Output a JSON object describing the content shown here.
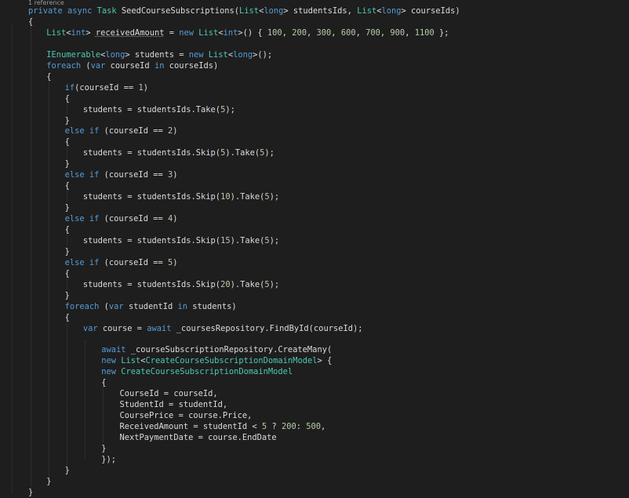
{
  "editor": {
    "codelens": "1 reference",
    "colors": {
      "background": "#1e1e1e",
      "default": "#dcdcdc",
      "keyword": "#569cd6",
      "type": "#4ec9b0",
      "number": "#b5cea8",
      "codelens": "#999999"
    },
    "lines": [
      {
        "indent": 0,
        "tokens": [
          [
            "keyword",
            "private async "
          ],
          [
            "type",
            "Task"
          ],
          [
            "default",
            " SeedCourseSubscriptions("
          ],
          [
            "type",
            "List"
          ],
          [
            "default",
            "<"
          ],
          [
            "keyword",
            "long"
          ],
          [
            "default",
            "> studentsIds, "
          ],
          [
            "type",
            "List"
          ],
          [
            "default",
            "<"
          ],
          [
            "keyword",
            "long"
          ],
          [
            "default",
            "> courseIds)"
          ]
        ]
      },
      {
        "indent": 0,
        "tokens": [
          [
            "default",
            "{"
          ]
        ]
      },
      {
        "indent": 1,
        "tokens": [
          [
            "type",
            "List"
          ],
          [
            "default",
            "<"
          ],
          [
            "keyword",
            "int"
          ],
          [
            "default",
            "> "
          ],
          [
            "squiggle",
            "receivedAmount"
          ],
          [
            "default",
            " = "
          ],
          [
            "keyword",
            "new "
          ],
          [
            "type",
            "List"
          ],
          [
            "default",
            "<"
          ],
          [
            "keyword",
            "int"
          ],
          [
            "default",
            ">() { "
          ],
          [
            "number",
            "100"
          ],
          [
            "default",
            ", "
          ],
          [
            "number",
            "200"
          ],
          [
            "default",
            ", "
          ],
          [
            "number",
            "300"
          ],
          [
            "default",
            ", "
          ],
          [
            "number",
            "600"
          ],
          [
            "default",
            ", "
          ],
          [
            "number",
            "700"
          ],
          [
            "default",
            ", "
          ],
          [
            "number",
            "900"
          ],
          [
            "default",
            ", "
          ],
          [
            "number",
            "1100"
          ],
          [
            "default",
            " };"
          ]
        ]
      },
      {
        "indent": 1,
        "tokens": []
      },
      {
        "indent": 1,
        "tokens": [
          [
            "type",
            "IEnumerable"
          ],
          [
            "default",
            "<"
          ],
          [
            "keyword",
            "long"
          ],
          [
            "default",
            "> students = "
          ],
          [
            "keyword",
            "new "
          ],
          [
            "type",
            "List"
          ],
          [
            "default",
            "<"
          ],
          [
            "keyword",
            "long"
          ],
          [
            "default",
            ">();"
          ]
        ]
      },
      {
        "indent": 1,
        "tokens": [
          [
            "keyword",
            "foreach"
          ],
          [
            "default",
            " ("
          ],
          [
            "keyword",
            "var"
          ],
          [
            "default",
            " courseId "
          ],
          [
            "keyword",
            "in"
          ],
          [
            "default",
            " courseIds)"
          ]
        ]
      },
      {
        "indent": 1,
        "tokens": [
          [
            "default",
            "{"
          ]
        ]
      },
      {
        "indent": 2,
        "tokens": [
          [
            "keyword",
            "if"
          ],
          [
            "default",
            "(courseId == "
          ],
          [
            "number",
            "1"
          ],
          [
            "default",
            ")"
          ]
        ]
      },
      {
        "indent": 2,
        "tokens": [
          [
            "default",
            "{"
          ]
        ]
      },
      {
        "indent": 3,
        "tokens": [
          [
            "default",
            "students = studentsIds.Take("
          ],
          [
            "number",
            "5"
          ],
          [
            "default",
            ");"
          ]
        ]
      },
      {
        "indent": 2,
        "tokens": [
          [
            "default",
            "}"
          ]
        ]
      },
      {
        "indent": 2,
        "tokens": [
          [
            "keyword",
            "else if"
          ],
          [
            "default",
            " (courseId == "
          ],
          [
            "number",
            "2"
          ],
          [
            "default",
            ")"
          ]
        ]
      },
      {
        "indent": 2,
        "tokens": [
          [
            "default",
            "{"
          ]
        ]
      },
      {
        "indent": 3,
        "tokens": [
          [
            "default",
            "students = studentsIds.Skip("
          ],
          [
            "number",
            "5"
          ],
          [
            "default",
            ").Take("
          ],
          [
            "number",
            "5"
          ],
          [
            "default",
            ");"
          ]
        ]
      },
      {
        "indent": 2,
        "tokens": [
          [
            "default",
            "}"
          ]
        ]
      },
      {
        "indent": 2,
        "tokens": [
          [
            "keyword",
            "else if"
          ],
          [
            "default",
            " (courseId == "
          ],
          [
            "number",
            "3"
          ],
          [
            "default",
            ")"
          ]
        ]
      },
      {
        "indent": 2,
        "tokens": [
          [
            "default",
            "{"
          ]
        ]
      },
      {
        "indent": 3,
        "tokens": [
          [
            "default",
            "students = studentsIds.Skip("
          ],
          [
            "number",
            "10"
          ],
          [
            "default",
            ").Take("
          ],
          [
            "number",
            "5"
          ],
          [
            "default",
            ");"
          ]
        ]
      },
      {
        "indent": 2,
        "tokens": [
          [
            "default",
            "}"
          ]
        ]
      },
      {
        "indent": 2,
        "tokens": [
          [
            "keyword",
            "else if"
          ],
          [
            "default",
            " (courseId == "
          ],
          [
            "number",
            "4"
          ],
          [
            "default",
            ")"
          ]
        ]
      },
      {
        "indent": 2,
        "tokens": [
          [
            "default",
            "{"
          ]
        ]
      },
      {
        "indent": 3,
        "tokens": [
          [
            "default",
            "students = studentsIds.Skip("
          ],
          [
            "number",
            "15"
          ],
          [
            "default",
            ").Take("
          ],
          [
            "number",
            "5"
          ],
          [
            "default",
            ");"
          ]
        ]
      },
      {
        "indent": 2,
        "tokens": [
          [
            "default",
            "}"
          ]
        ]
      },
      {
        "indent": 2,
        "tokens": [
          [
            "keyword",
            "else if"
          ],
          [
            "default",
            " (courseId == "
          ],
          [
            "number",
            "5"
          ],
          [
            "default",
            ")"
          ]
        ]
      },
      {
        "indent": 2,
        "tokens": [
          [
            "default",
            "{"
          ]
        ]
      },
      {
        "indent": 3,
        "tokens": [
          [
            "default",
            "students = studentsIds.Skip("
          ],
          [
            "number",
            "20"
          ],
          [
            "default",
            ").Take("
          ],
          [
            "number",
            "5"
          ],
          [
            "default",
            ");"
          ]
        ]
      },
      {
        "indent": 2,
        "tokens": [
          [
            "default",
            "}"
          ]
        ]
      },
      {
        "indent": 2,
        "tokens": [
          [
            "keyword",
            "foreach"
          ],
          [
            "default",
            " ("
          ],
          [
            "keyword",
            "var"
          ],
          [
            "default",
            " studentId "
          ],
          [
            "keyword",
            "in"
          ],
          [
            "default",
            " students)"
          ]
        ]
      },
      {
        "indent": 2,
        "tokens": [
          [
            "default",
            "{"
          ]
        ]
      },
      {
        "indent": 3,
        "tokens": [
          [
            "keyword",
            "var"
          ],
          [
            "default",
            " course = "
          ],
          [
            "keyword",
            "await"
          ],
          [
            "default",
            " _coursesRepository.FindById(courseId);"
          ]
        ]
      },
      {
        "indent": 3,
        "tokens": []
      },
      {
        "indent": 4,
        "tokens": [
          [
            "keyword",
            "await"
          ],
          [
            "default",
            " _courseSubscriptionRepository.CreateMany("
          ]
        ]
      },
      {
        "indent": 4,
        "tokens": [
          [
            "keyword",
            "new "
          ],
          [
            "type",
            "List"
          ],
          [
            "default",
            "<"
          ],
          [
            "type",
            "CreateCourseSubscriptionDomainModel"
          ],
          [
            "default",
            "> {"
          ]
        ]
      },
      {
        "indent": 4,
        "tokens": [
          [
            "keyword",
            "new "
          ],
          [
            "type",
            "CreateCourseSubscriptionDomainModel"
          ]
        ]
      },
      {
        "indent": 4,
        "tokens": [
          [
            "default",
            "{"
          ]
        ]
      },
      {
        "indent": 5,
        "tokens": [
          [
            "default",
            "CourseId = courseId,"
          ]
        ]
      },
      {
        "indent": 5,
        "tokens": [
          [
            "default",
            "StudentId = studentId,"
          ]
        ]
      },
      {
        "indent": 5,
        "tokens": [
          [
            "default",
            "CoursePrice = course.Price,"
          ]
        ]
      },
      {
        "indent": 5,
        "tokens": [
          [
            "default",
            "ReceivedAmount = studentId < "
          ],
          [
            "number",
            "5"
          ],
          [
            "default",
            " ? "
          ],
          [
            "number",
            "200"
          ],
          [
            "default",
            ": "
          ],
          [
            "number",
            "500"
          ],
          [
            "default",
            ","
          ]
        ]
      },
      {
        "indent": 5,
        "tokens": [
          [
            "default",
            "NextPaymentDate = course.EndDate"
          ]
        ]
      },
      {
        "indent": 4,
        "tokens": [
          [
            "default",
            "}"
          ]
        ]
      },
      {
        "indent": 4,
        "tokens": [
          [
            "default",
            "});"
          ]
        ]
      },
      {
        "indent": 2,
        "tokens": [
          [
            "default",
            "}"
          ]
        ]
      },
      {
        "indent": 1,
        "tokens": [
          [
            "default",
            "}"
          ]
        ]
      },
      {
        "indent": 0,
        "tokens": [
          [
            "default",
            "}"
          ]
        ]
      }
    ]
  }
}
